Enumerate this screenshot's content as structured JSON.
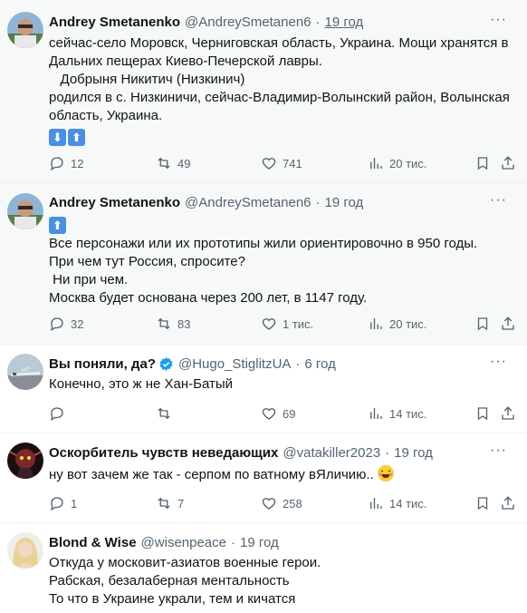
{
  "tweets": [
    {
      "name": "Andrey Smetanenko",
      "handle": "@AndreySmetanen6",
      "time": "19 год",
      "text": "сейчас-село Моровск, Черниговская область, Украина. Мощи хранятся в\nДальних пещерах Киево-Печерской лавры.\n   Добрыня Никитич (Низкинич)\nродился в с. Низкиничи, сейчас-Владимир-Волынский район, Волынская\nобласть, Украина.",
      "emoji_line": [
        "down-arrow-emoji",
        "up-arrow-emoji"
      ],
      "replies": "12",
      "reposts": "49",
      "likes": "741",
      "views": "20 тис."
    },
    {
      "name": "Andrey Smetanenko",
      "handle": "@AndreySmetanen6",
      "time": "19 год",
      "emoji_top": "up-arrow-emoji",
      "text": "Все персонажи или их прототипы жили ориентировочно в 950 годы.\nПри чем тут Россия, спросите?\n Ни при чем.\nМосква будет основана через 200 лет, в 1147 году.",
      "replies": "32",
      "reposts": "83",
      "likes": "1 тис.",
      "views": "20 тис."
    },
    {
      "name": "Вы поняли, да?",
      "handle": "@Hugo_StiglitzUA",
      "time": "6 год",
      "text": "Конечно, это ж не Хан-Батый",
      "replies": "",
      "reposts": "",
      "likes": "69",
      "views": "14 тис."
    },
    {
      "name": "Оскорбитель чувств неведающих",
      "handle": "@vatakiller2023",
      "time": "19 год",
      "text": "ну вот зачем же так - серпом по ватному вЯличию.. ",
      "replies": "1",
      "reposts": "7",
      "likes": "258",
      "views": "14 тис."
    },
    {
      "name": "Blond & Wise",
      "handle": "@wisenpeace",
      "time": "19 год",
      "text": "Откуда у московит-азиатов военные герои.\nРабская, безалаберная ментальность\nТо что в Украине украли, тем и кичатся"
    }
  ],
  "colors": {
    "accent": "#1d9bf0",
    "muted": "#536471",
    "text": "#0f1419",
    "emoji_blue": "#4a90e2"
  },
  "icons": [
    "reply-icon",
    "repost-icon",
    "like-icon",
    "views-icon",
    "bookmark-icon",
    "share-icon",
    "more-icon",
    "verified-icon"
  ]
}
